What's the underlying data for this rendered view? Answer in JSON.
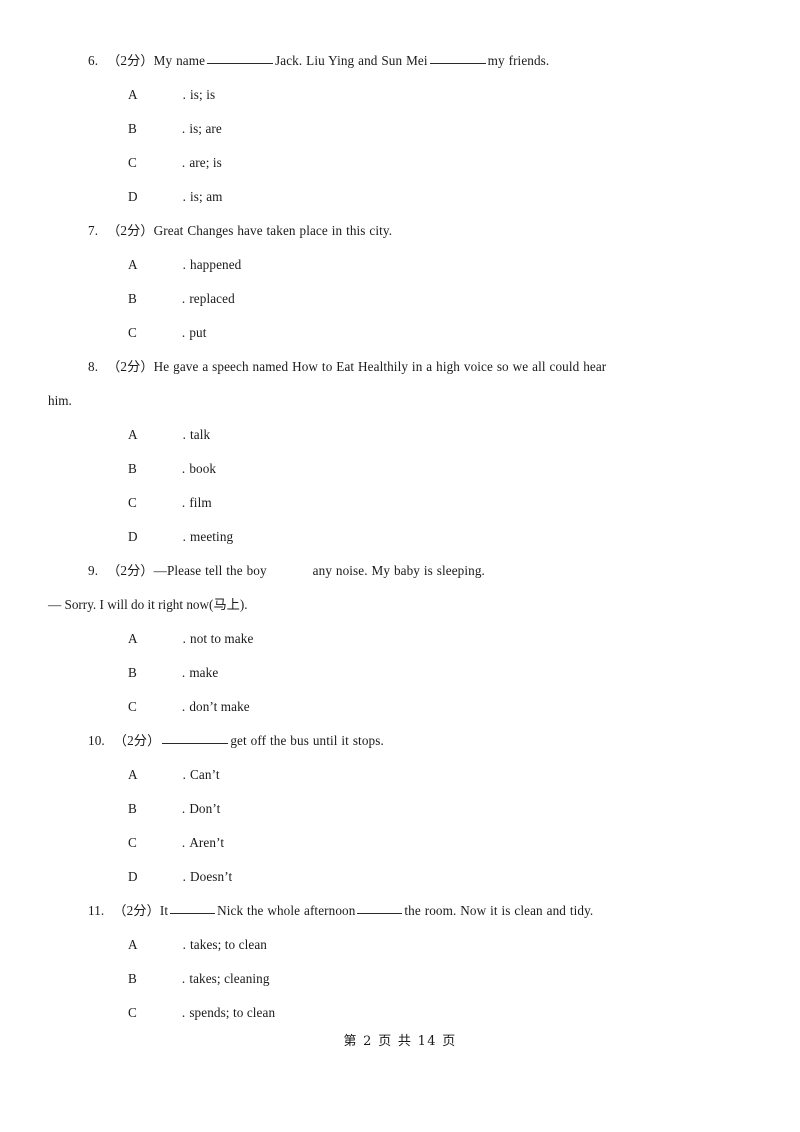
{
  "document": {
    "page_label": "第 2 页 共 14 页",
    "page_number": "2",
    "total_pages": "14"
  },
  "questions": [
    {
      "number": "6.",
      "marks": "（2分）",
      "stem_part_1": "My name",
      "stem_part_2": "Jack. Liu Ying and Sun Mei",
      "stem_part_3": "my friends.",
      "options": [
        {
          "letter": "A",
          "dot": ".",
          "text": "is; is"
        },
        {
          "letter": "B",
          "dot": ".",
          "text": "is; are"
        },
        {
          "letter": "C",
          "dot": ".",
          "text": "are; is"
        },
        {
          "letter": "D",
          "dot": ".",
          "text": "is; am"
        }
      ]
    },
    {
      "number": "7.",
      "marks": "（2分）",
      "stem_part_1": "Great Changes have taken place in this city.",
      "options": [
        {
          "letter": "A",
          "dot": ".",
          "text": "happened"
        },
        {
          "letter": "B",
          "dot": ".",
          "text": "replaced"
        },
        {
          "letter": "C",
          "dot": ".",
          "text": "put"
        }
      ]
    },
    {
      "number": "8.",
      "marks": "（2分）",
      "stem_part_1": "He gave a speech named How to Eat Healthily in a high voice so we all could hear",
      "stem_wrap": "him.",
      "options": [
        {
          "letter": "A",
          "dot": ".",
          "text": "talk"
        },
        {
          "letter": "B",
          "dot": ".",
          "text": "book"
        },
        {
          "letter": "C",
          "dot": ".",
          "text": "film"
        },
        {
          "letter": "D",
          "dot": ".",
          "text": "meeting"
        }
      ]
    },
    {
      "number": "9.",
      "marks": "（2分）",
      "stem_part_1": "—Please tell the boy",
      "stem_part_2": "any noise. My baby is sleeping.",
      "stem_line_2": "— Sorry. I will do it right now(马上).",
      "options": [
        {
          "letter": "A",
          "dot": ".",
          "text": "not to make"
        },
        {
          "letter": "B",
          "dot": ".",
          "text": "make"
        },
        {
          "letter": "C",
          "dot": ".",
          "text": "don’t make"
        }
      ]
    },
    {
      "number": "10.",
      "marks": "（2分）",
      "stem_part_1": "",
      "stem_part_2": "get off the bus until it stops.",
      "options": [
        {
          "letter": "A",
          "dot": ".",
          "text": "Can’t"
        },
        {
          "letter": "B",
          "dot": ".",
          "text": "Don’t"
        },
        {
          "letter": "C",
          "dot": ".",
          "text": "Aren’t"
        },
        {
          "letter": "D",
          "dot": ".",
          "text": "Doesn’t"
        }
      ]
    },
    {
      "number": "11.",
      "marks": "（2分）",
      "stem_part_1": "It",
      "stem_part_2": "Nick the whole afternoon",
      "stem_part_3": "the room. Now it is clean and tidy.",
      "options": [
        {
          "letter": "A",
          "dot": ".",
          "text": "takes; to clean"
        },
        {
          "letter": "B",
          "dot": ".",
          "text": "takes; cleaning"
        },
        {
          "letter": "C",
          "dot": ".",
          "text": "spends; to clean"
        }
      ]
    }
  ]
}
